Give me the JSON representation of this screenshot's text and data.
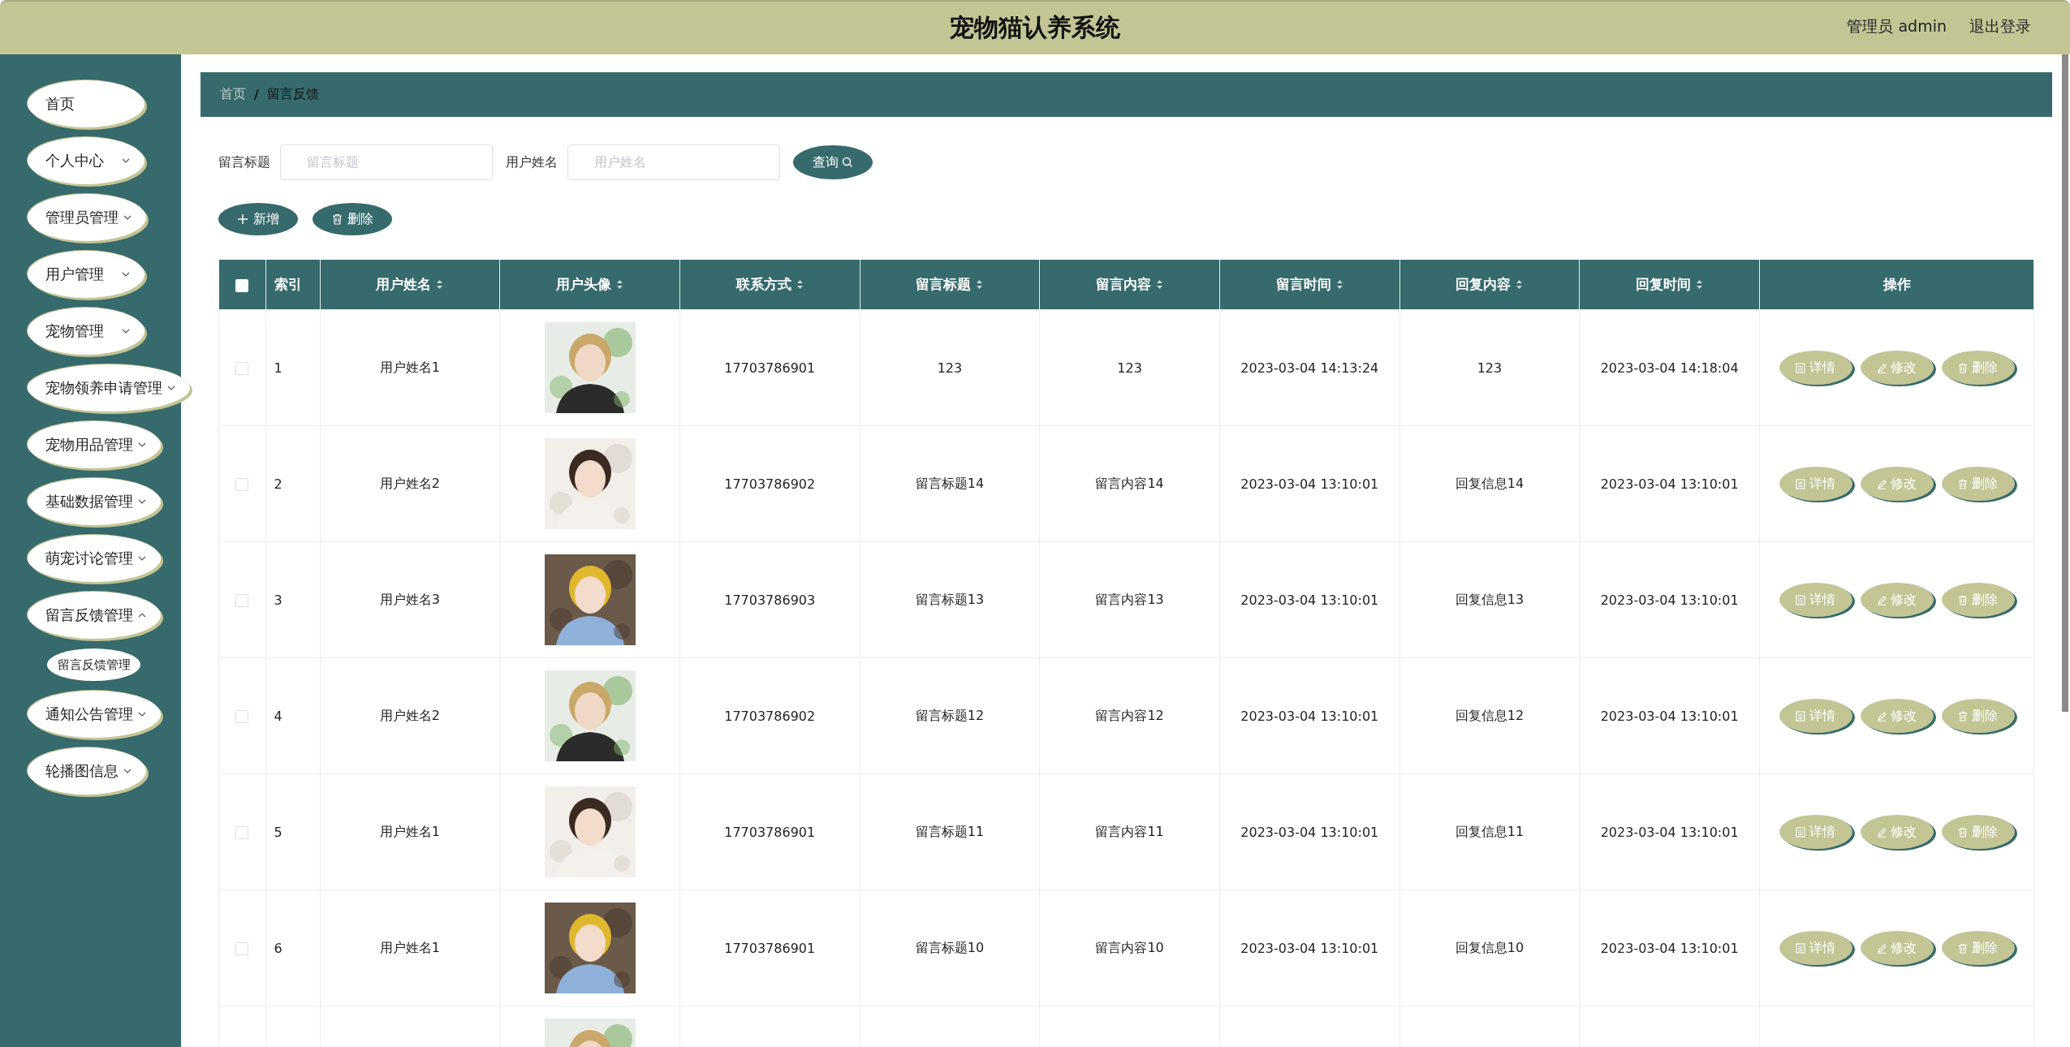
{
  "header": {
    "title": "宠物猫认养系统",
    "user": "管理员 admin",
    "logout": "退出登录"
  },
  "sidebar": {
    "items": [
      {
        "label": "首页",
        "expandable": false
      },
      {
        "label": "个人中心",
        "expandable": true,
        "expanded": false
      },
      {
        "label": "管理员管理",
        "expandable": true,
        "expanded": false
      },
      {
        "label": "用户管理",
        "expandable": true,
        "expanded": false
      },
      {
        "label": "宠物管理",
        "expandable": true,
        "expanded": false
      },
      {
        "label": "宠物领养申请管理",
        "expandable": true,
        "expanded": false
      },
      {
        "label": "宠物用品管理",
        "expandable": true,
        "expanded": false
      },
      {
        "label": "基础数据管理",
        "expandable": true,
        "expanded": false
      },
      {
        "label": "萌宠讨论管理",
        "expandable": true,
        "expanded": false
      },
      {
        "label": "留言反馈管理",
        "expandable": true,
        "expanded": true,
        "children": [
          {
            "label": "留言反馈管理"
          }
        ]
      },
      {
        "label": "通知公告管理",
        "expandable": true,
        "expanded": false
      },
      {
        "label": "轮播图信息",
        "expandable": true,
        "expanded": false
      }
    ]
  },
  "breadcrumb": {
    "items": [
      "首页",
      "留言反馈"
    ],
    "separator": "/"
  },
  "search": {
    "fields": [
      {
        "label": "留言标题",
        "placeholder": "留言标题"
      },
      {
        "label": "用户姓名",
        "placeholder": "用户姓名"
      }
    ],
    "button": "查询"
  },
  "actions": [
    {
      "kind": "add",
      "label": "新增"
    },
    {
      "kind": "delete",
      "label": "删除"
    }
  ],
  "table": {
    "header_checked": false,
    "columns": [
      {
        "label": "索引",
        "sortable": false
      },
      {
        "label": "用户姓名",
        "sortable": true
      },
      {
        "label": "用户头像",
        "sortable": true
      },
      {
        "label": "联系方式",
        "sortable": true
      },
      {
        "label": "留言标题",
        "sortable": true
      },
      {
        "label": "留言内容",
        "sortable": true
      },
      {
        "label": "留言时间",
        "sortable": true
      },
      {
        "label": "回复内容",
        "sortable": true
      },
      {
        "label": "回复时间",
        "sortable": true
      },
      {
        "label": "操作",
        "sortable": false
      }
    ],
    "rows": [
      {
        "checked": false,
        "index": "1",
        "name": "用户姓名1",
        "avatar": {
          "kind": "picture"
        },
        "phone": "17703786901",
        "title": "123",
        "content": "123",
        "time": "2023-03-04 14:13:24",
        "reply": "123",
        "reply_time": "2023-03-04 14:18:04",
        "buttons": [
          {
            "kind": "detail",
            "label": "详情"
          },
          {
            "kind": "edit",
            "label": "修改"
          },
          {
            "kind": "delete",
            "label": "删除"
          }
        ]
      },
      {
        "checked": false,
        "index": "2",
        "name": "用户姓名2",
        "avatar": {
          "kind": "picture"
        },
        "phone": "17703786902",
        "title": "留言标题14",
        "content": "留言内容14",
        "time": "2023-03-04 13:10:01",
        "reply": "回复信息14",
        "reply_time": "2023-03-04 13:10:01",
        "buttons": [
          {
            "kind": "detail",
            "label": "详情"
          },
          {
            "kind": "edit",
            "label": "修改"
          },
          {
            "kind": "delete",
            "label": "删除"
          }
        ]
      },
      {
        "checked": false,
        "index": "3",
        "name": "用户姓名3",
        "avatar": {
          "kind": "picture"
        },
        "phone": "17703786903",
        "title": "留言标题13",
        "content": "留言内容13",
        "time": "2023-03-04 13:10:01",
        "reply": "回复信息13",
        "reply_time": "2023-03-04 13:10:01",
        "buttons": [
          {
            "kind": "detail",
            "label": "详情"
          },
          {
            "kind": "edit",
            "label": "修改"
          },
          {
            "kind": "delete",
            "label": "删除"
          }
        ]
      },
      {
        "checked": false,
        "index": "4",
        "name": "用户姓名2",
        "avatar": {
          "kind": "picture"
        },
        "phone": "17703786902",
        "title": "留言标题12",
        "content": "留言内容12",
        "time": "2023-03-04 13:10:01",
        "reply": "回复信息12",
        "reply_time": "2023-03-04 13:10:01",
        "buttons": [
          {
            "kind": "detail",
            "label": "详情"
          },
          {
            "kind": "edit",
            "label": "修改"
          },
          {
            "kind": "delete",
            "label": "删除"
          }
        ]
      },
      {
        "checked": false,
        "index": "5",
        "name": "用户姓名1",
        "avatar": {
          "kind": "picture"
        },
        "phone": "17703786901",
        "title": "留言标题11",
        "content": "留言内容11",
        "time": "2023-03-04 13:10:01",
        "reply": "回复信息11",
        "reply_time": "2023-03-04 13:10:01",
        "buttons": [
          {
            "kind": "detail",
            "label": "详情"
          },
          {
            "kind": "edit",
            "label": "修改"
          },
          {
            "kind": "delete",
            "label": "删除"
          }
        ]
      },
      {
        "checked": false,
        "index": "6",
        "name": "用户姓名1",
        "avatar": {
          "kind": "picture"
        },
        "phone": "17703786901",
        "title": "留言标题10",
        "content": "留言内容10",
        "time": "2023-03-04 13:10:01",
        "reply": "回复信息10",
        "reply_time": "2023-03-04 13:10:01",
        "buttons": [
          {
            "kind": "detail",
            "label": "详情"
          },
          {
            "kind": "edit",
            "label": "修改"
          },
          {
            "kind": "delete",
            "label": "删除"
          }
        ]
      },
      {
        "avatar": {
          "kind": "picture"
        }
      }
    ]
  }
}
